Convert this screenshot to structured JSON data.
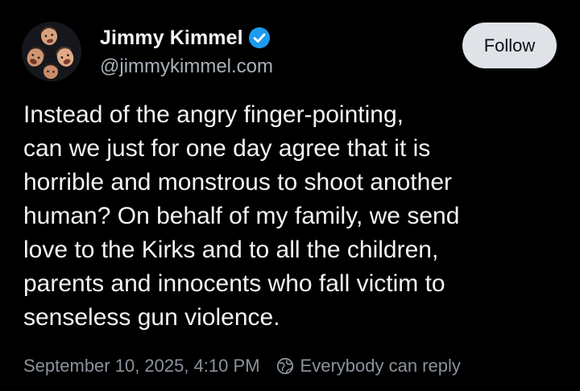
{
  "author": {
    "display_name": "Jimmy Kimmel",
    "handle": "@jimmykimmel.com",
    "verified": true,
    "avatar_icon": "avatar-icon"
  },
  "follow_button": {
    "label": "Follow"
  },
  "post": {
    "lines": [
      "Instead of the angry finger-pointing,",
      "can we just for one day agree that it is",
      "horrible and monstrous to shoot another",
      "human? On behalf of my family, we send",
      "love to the Kirks and to all the children,",
      "parents and innocents who fall victim to",
      "senseless gun violence."
    ]
  },
  "meta": {
    "timestamp": "September 10, 2025, 4:10 PM",
    "reply_setting": "Everybody can reply",
    "reply_icon": "reply-settings-icon"
  },
  "colors": {
    "background": "#000000",
    "text_primary": "#f1f3f5",
    "text_secondary": "#a9b0b9",
    "verified_blue": "#1d9bf0",
    "follow_button_bg": "#dfe3e8"
  }
}
